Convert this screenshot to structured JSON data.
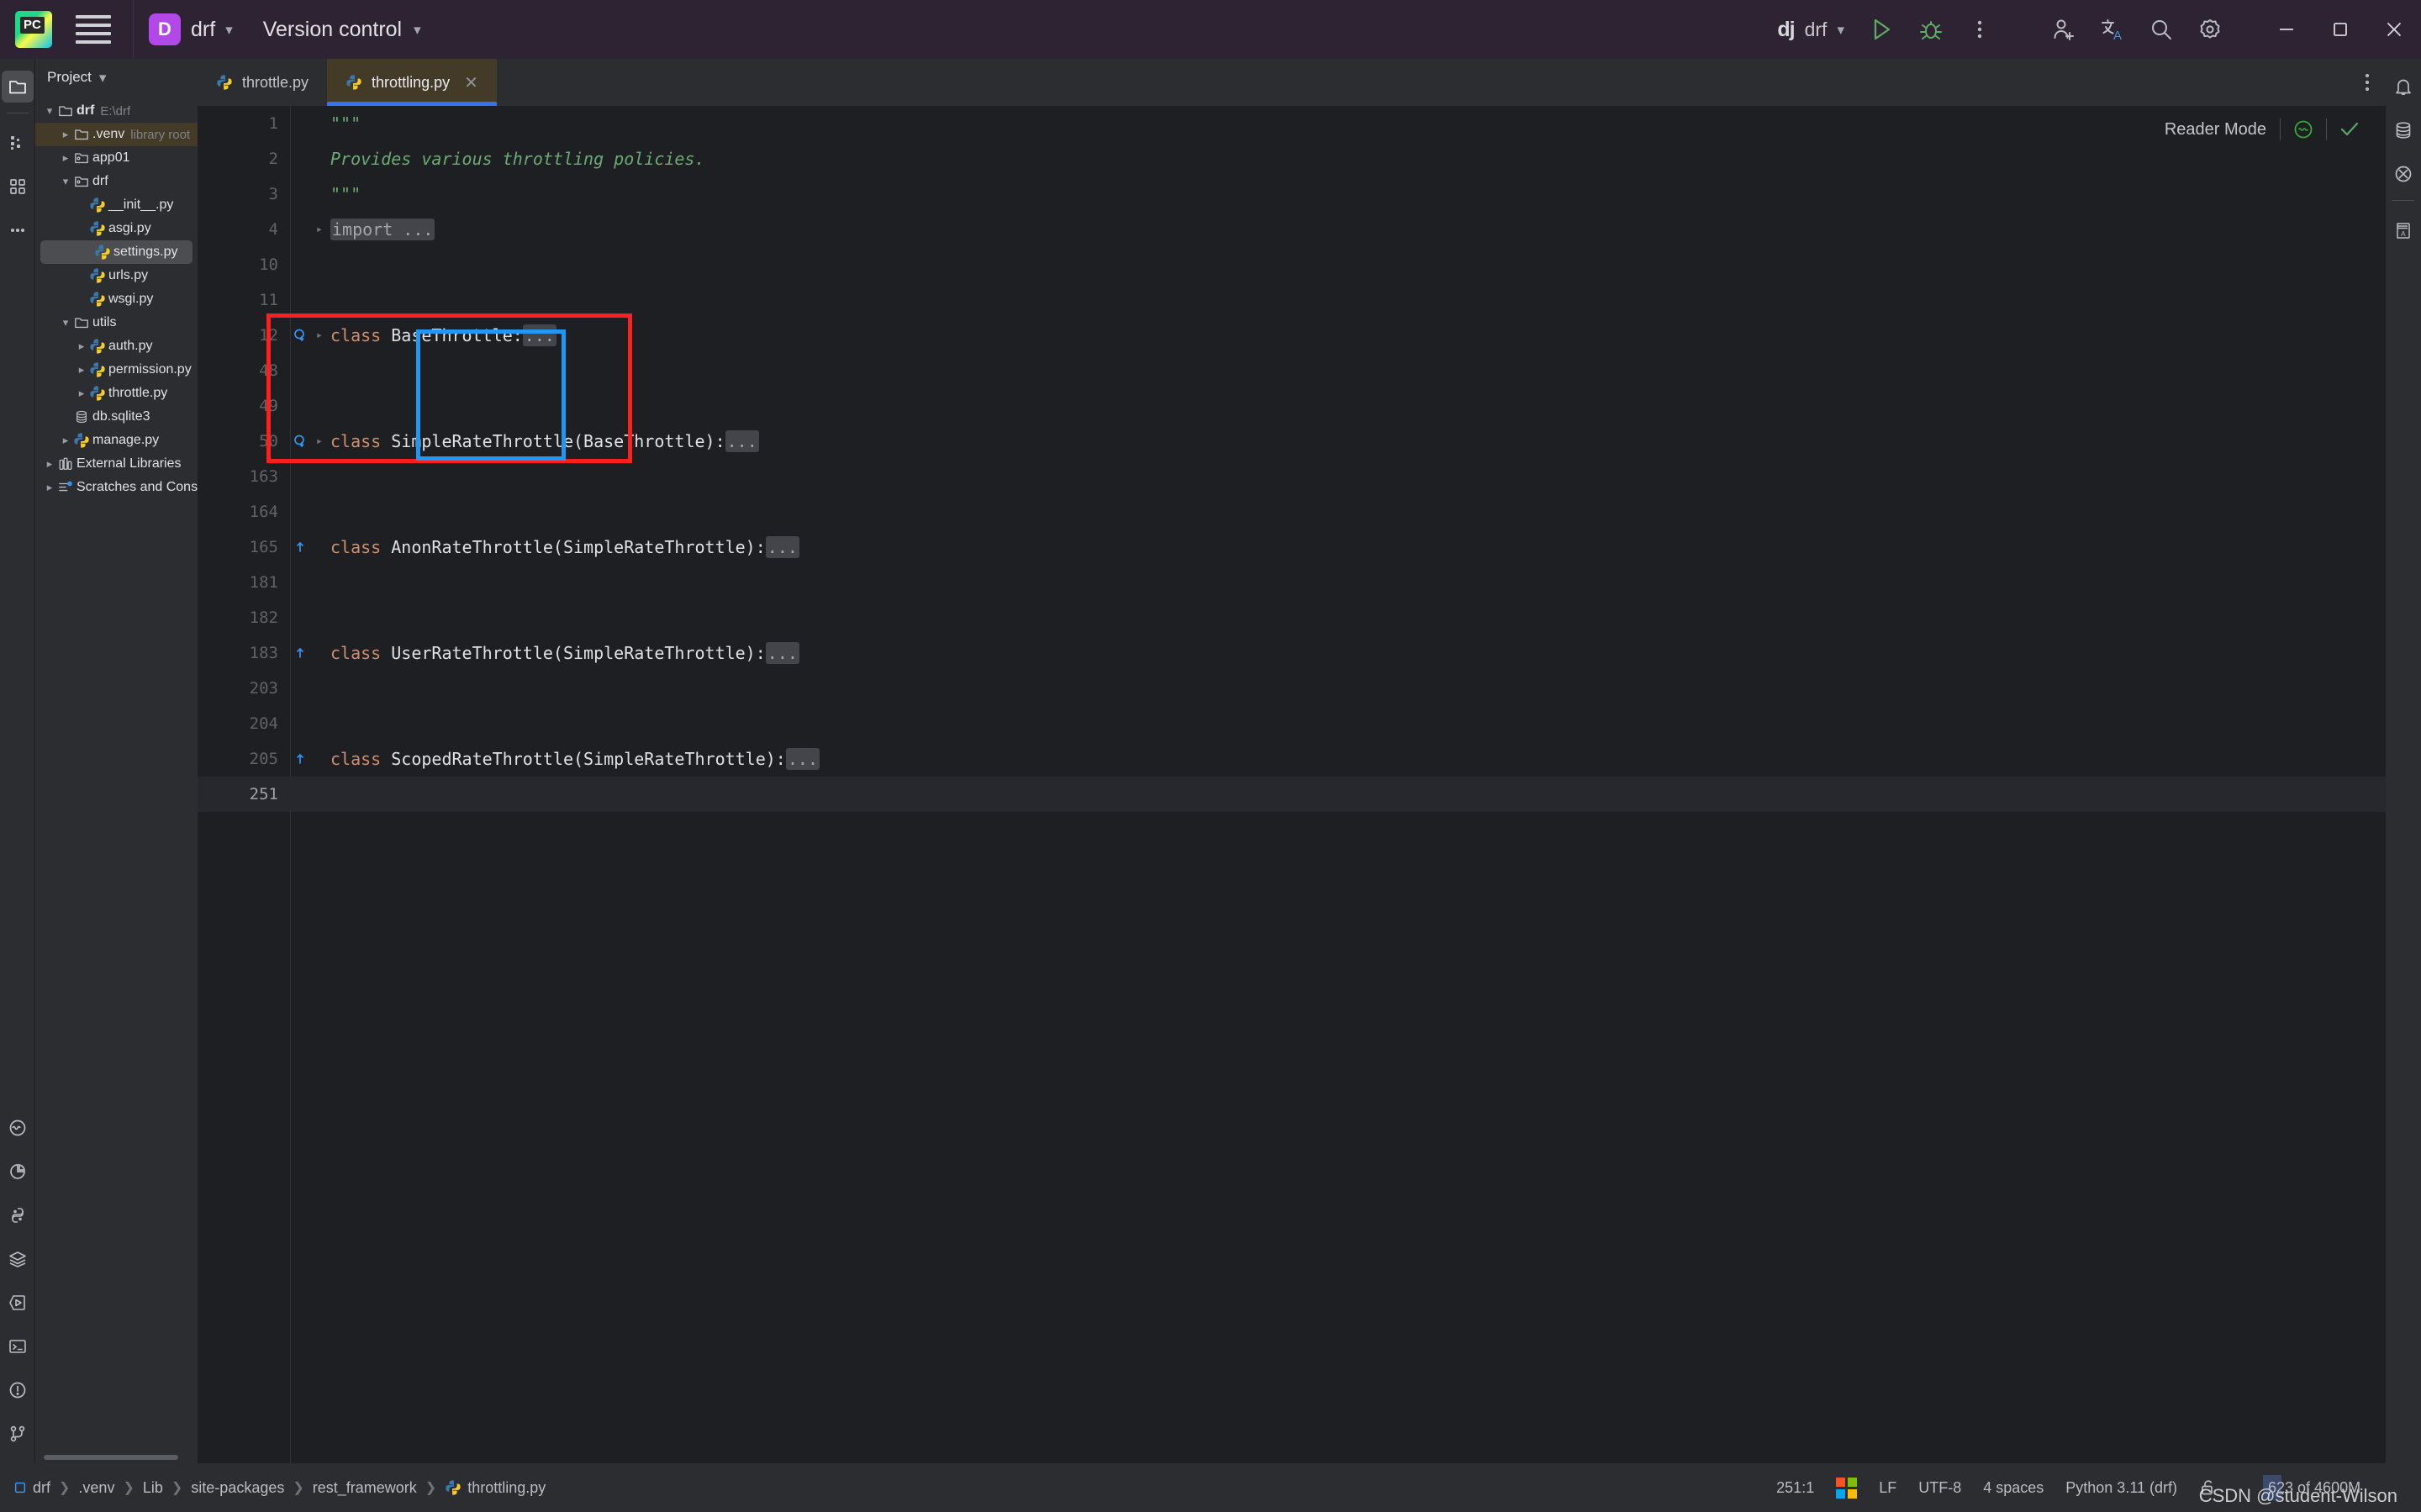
{
  "titlebar": {
    "logo_icon": "pycharm-logo",
    "menu_icon": "hamburger-menu-icon",
    "project_badge": "D",
    "project_name": "drf",
    "vcs_label": "Version control",
    "run_config_icon": "django-icon",
    "run_config_name": "drf",
    "run_icon": "run-icon",
    "debug_icon": "debug-icon",
    "more_icon": "more-vertical-icon",
    "share_icon": "add-user-icon",
    "translate_icon": "translate-icon",
    "search_icon": "search-icon",
    "settings_icon": "settings-gear-icon",
    "minimize_icon": "minimize-icon",
    "maximize_icon": "maximize-icon",
    "close_icon": "close-icon"
  },
  "activitybar": {
    "items": [
      {
        "name": "project-tool-window",
        "icon": "folder-icon",
        "selected": true
      },
      {
        "name": "commit-tool-window",
        "icon": "commit-icon",
        "selected": false
      },
      {
        "name": "structure-tool-window",
        "icon": "structure-icon",
        "selected": false
      },
      {
        "name": "more-tool-windows",
        "icon": "more-horizontal-icon",
        "selected": false
      }
    ],
    "bottom_items": [
      {
        "name": "problems-tool-window",
        "icon": "inspection-icon"
      },
      {
        "name": "profiler-tool-window",
        "icon": "profiler-icon"
      },
      {
        "name": "python-console",
        "icon": "python-icon"
      },
      {
        "name": "services-tool-window",
        "icon": "layers-icon"
      },
      {
        "name": "run-tool-window",
        "icon": "run-hex-icon"
      },
      {
        "name": "terminal-tool-window",
        "icon": "terminal-icon"
      },
      {
        "name": "problems-panel",
        "icon": "warning-circle-icon"
      },
      {
        "name": "version-control-tool-window",
        "icon": "branch-icon"
      }
    ]
  },
  "rightbar": {
    "items": [
      {
        "name": "notifications",
        "icon": "bell-icon"
      },
      {
        "name": "database-tool-window",
        "icon": "database-icon"
      },
      {
        "name": "sciview-tool-window",
        "icon": "sciview-icon"
      },
      {
        "name": "translation-tool-window",
        "icon": "book-a-icon"
      }
    ]
  },
  "project_panel": {
    "title": "Project",
    "title_chevron": "chevron-down-icon",
    "tree": [
      {
        "label": "drf",
        "sub": "E:\\drf",
        "icon": "folder-icon",
        "arrow": "expanded",
        "indent": 0,
        "bold": true,
        "state": "normal"
      },
      {
        "label": ".venv",
        "sub": "library root",
        "icon": "folder-icon",
        "arrow": "collapsed",
        "indent": 1,
        "bold": false,
        "state": "highlight"
      },
      {
        "label": "app01",
        "sub": "",
        "icon": "module-folder-icon",
        "arrow": "collapsed",
        "indent": 1,
        "bold": false,
        "state": "normal"
      },
      {
        "label": "drf",
        "sub": "",
        "icon": "module-folder-icon",
        "arrow": "expanded",
        "indent": 1,
        "bold": false,
        "state": "normal"
      },
      {
        "label": "__init__.py",
        "sub": "",
        "icon": "python-file-icon",
        "arrow": "none",
        "indent": 2,
        "bold": false,
        "state": "normal"
      },
      {
        "label": "asgi.py",
        "sub": "",
        "icon": "python-file-icon",
        "arrow": "none",
        "indent": 2,
        "bold": false,
        "state": "normal"
      },
      {
        "label": "settings.py",
        "sub": "",
        "icon": "python-file-icon",
        "arrow": "none",
        "indent": 2,
        "bold": false,
        "state": "selected"
      },
      {
        "label": "urls.py",
        "sub": "",
        "icon": "python-file-icon",
        "arrow": "none",
        "indent": 2,
        "bold": false,
        "state": "normal"
      },
      {
        "label": "wsgi.py",
        "sub": "",
        "icon": "python-file-icon",
        "arrow": "none",
        "indent": 2,
        "bold": false,
        "state": "normal"
      },
      {
        "label": "utils",
        "sub": "",
        "icon": "folder-icon",
        "arrow": "expanded",
        "indent": 1,
        "bold": false,
        "state": "normal"
      },
      {
        "label": "auth.py",
        "sub": "",
        "icon": "python-file-icon",
        "arrow": "collapsed",
        "indent": 2,
        "bold": false,
        "state": "normal"
      },
      {
        "label": "permission.py",
        "sub": "",
        "icon": "python-file-icon",
        "arrow": "collapsed",
        "indent": 2,
        "bold": false,
        "state": "normal"
      },
      {
        "label": "throttle.py",
        "sub": "",
        "icon": "python-file-icon",
        "arrow": "collapsed",
        "indent": 2,
        "bold": false,
        "state": "normal"
      },
      {
        "label": "db.sqlite3",
        "sub": "",
        "icon": "database-file-icon",
        "arrow": "none",
        "indent": 1,
        "bold": false,
        "state": "normal"
      },
      {
        "label": "manage.py",
        "sub": "",
        "icon": "python-file-icon",
        "arrow": "collapsed",
        "indent": 1,
        "bold": false,
        "state": "normal"
      },
      {
        "label": "External Libraries",
        "sub": "",
        "icon": "library-icon",
        "arrow": "collapsed",
        "indent": 0,
        "bold": false,
        "state": "normal"
      },
      {
        "label": "Scratches and Consoles",
        "sub": "",
        "icon": "scratches-icon",
        "arrow": "collapsed",
        "indent": 0,
        "bold": false,
        "state": "normal"
      }
    ]
  },
  "editor": {
    "tabs": [
      {
        "label": "throttle.py",
        "icon": "python-file-icon",
        "active": false,
        "closable": false
      },
      {
        "label": "throttling.py",
        "icon": "python-file-icon",
        "active": true,
        "closable": true,
        "close_icon": "close-icon"
      }
    ],
    "tab_options_icon": "more-vertical-icon",
    "reader_mode": {
      "label": "Reader Mode",
      "inspections_icon": "inspections-widget-icon",
      "status_icon": "checkmark-icon"
    },
    "lines": [
      {
        "num": "1",
        "gutter": "",
        "fold": "",
        "segments": [
          {
            "t": "\"\"\"",
            "c": "doc"
          }
        ]
      },
      {
        "num": "2",
        "gutter": "",
        "fold": "",
        "segments": [
          {
            "t": "Provides various throttling policies.",
            "c": "doc"
          }
        ]
      },
      {
        "num": "3",
        "gutter": "",
        "fold": "",
        "segments": [
          {
            "t": "\"\"\"",
            "c": "doc"
          }
        ]
      },
      {
        "num": "4",
        "gutter": "",
        "fold": "chevron-right",
        "segments": [
          {
            "t": "import ...",
            "c": "fold"
          }
        ]
      },
      {
        "num": "10",
        "gutter": "",
        "fold": "",
        "segments": []
      },
      {
        "num": "11",
        "gutter": "",
        "fold": "",
        "segments": []
      },
      {
        "num": "12",
        "gutter": "implemented-by",
        "fold": "chevron-right",
        "segments": [
          {
            "t": "class ",
            "c": "kw"
          },
          {
            "t": "BaseThrottle:",
            "c": "cls"
          },
          {
            "t": "...",
            "c": "fold"
          }
        ]
      },
      {
        "num": "48",
        "gutter": "",
        "fold": "",
        "segments": []
      },
      {
        "num": "49",
        "gutter": "",
        "fold": "",
        "segments": []
      },
      {
        "num": "50",
        "gutter": "implemented-by",
        "fold": "chevron-right",
        "segments": [
          {
            "t": "class ",
            "c": "kw"
          },
          {
            "t": "SimpleRateThrottle(BaseThrottle):",
            "c": "cls"
          },
          {
            "t": "...",
            "c": "fold"
          }
        ]
      },
      {
        "num": "163",
        "gutter": "",
        "fold": "",
        "segments": []
      },
      {
        "num": "164",
        "gutter": "",
        "fold": "",
        "segments": []
      },
      {
        "num": "165",
        "gutter": "overrides",
        "fold": "",
        "segments": [
          {
            "t": "class ",
            "c": "kw"
          },
          {
            "t": "AnonRateThrottle(SimpleRateThrottle):",
            "c": "cls"
          },
          {
            "t": "...",
            "c": "fold"
          }
        ]
      },
      {
        "num": "181",
        "gutter": "",
        "fold": "",
        "segments": []
      },
      {
        "num": "182",
        "gutter": "",
        "fold": "",
        "segments": []
      },
      {
        "num": "183",
        "gutter": "overrides",
        "fold": "",
        "segments": [
          {
            "t": "class ",
            "c": "kw"
          },
          {
            "t": "UserRateThrottle(SimpleRateThrottle):",
            "c": "cls"
          },
          {
            "t": "...",
            "c": "fold"
          }
        ]
      },
      {
        "num": "203",
        "gutter": "",
        "fold": "",
        "segments": []
      },
      {
        "num": "204",
        "gutter": "",
        "fold": "",
        "segments": []
      },
      {
        "num": "205",
        "gutter": "overrides",
        "fold": "",
        "segments": [
          {
            "t": "class ",
            "c": "kw"
          },
          {
            "t": "ScopedRateThrottle(SimpleRateThrottle):",
            "c": "cls"
          },
          {
            "t": "...",
            "c": "fold"
          }
        ]
      },
      {
        "num": "251",
        "gutter": "",
        "fold": "",
        "current": true,
        "segments": []
      }
    ],
    "annotations": [
      {
        "name": "red-highlight-box",
        "color": "#ff1f1f"
      },
      {
        "name": "blue-highlight-box",
        "color": "#2196f3"
      }
    ]
  },
  "statusbar": {
    "breadcrumbs": [
      {
        "label": "drf",
        "icon": "module-icon"
      },
      {
        "label": ".venv",
        "icon": ""
      },
      {
        "label": "Lib",
        "icon": ""
      },
      {
        "label": "site-packages",
        "icon": ""
      },
      {
        "label": "rest_framework",
        "icon": ""
      },
      {
        "label": "throttling.py",
        "icon": "python-file-icon"
      }
    ],
    "caret_position": "251:1",
    "os_icon": "windows-icon",
    "line_separator": "LF",
    "encoding": "UTF-8",
    "indent": "4 spaces",
    "interpreter": "Python 3.11 (drf)",
    "lock_icon": "unlocked-icon",
    "memory": "623 of 4600M",
    "watermark": "CSDN @student-Wilson"
  },
  "colors": {
    "titlebar_bg": "#2e2333",
    "panel_bg": "#2b2d30",
    "editor_bg": "#1e1f22",
    "accent_blue": "#3574f0",
    "tab_active_bg": "#433a28",
    "keyword": "#cf8e6d",
    "string": "#6aab73",
    "annotation_red": "#ff1f1f",
    "annotation_blue": "#2196f3"
  }
}
